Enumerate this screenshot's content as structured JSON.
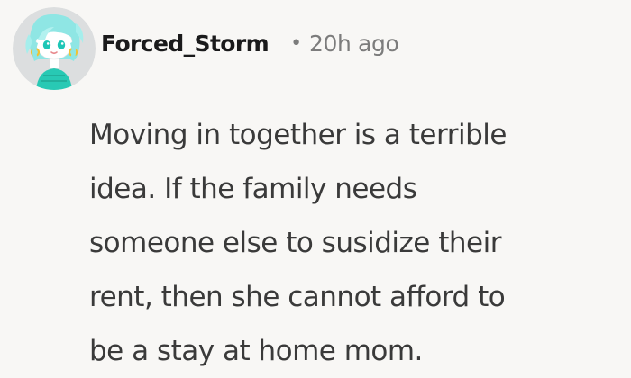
{
  "comment": {
    "author": "Forced_Storm",
    "separator": "•",
    "time_ago": "20h ago",
    "body_lines": [
      "Moving in together is a terrible",
      "idea. If the family needs",
      "someone else to susidize their",
      "rent, then she cannot afford to",
      "be a stay at home mom."
    ],
    "avatar_icon": "snoo-avatar-icon"
  },
  "colors": {
    "background": "#f8f7f5",
    "username": "#1a1a1b",
    "meta": "#7c7c7c",
    "body": "#3a3a3a",
    "avatar_bg": "#dcdedf",
    "avatar_hair": "#8fe6e4",
    "avatar_outfit": "#28c9b4",
    "avatar_accessory": "#f1c232"
  }
}
